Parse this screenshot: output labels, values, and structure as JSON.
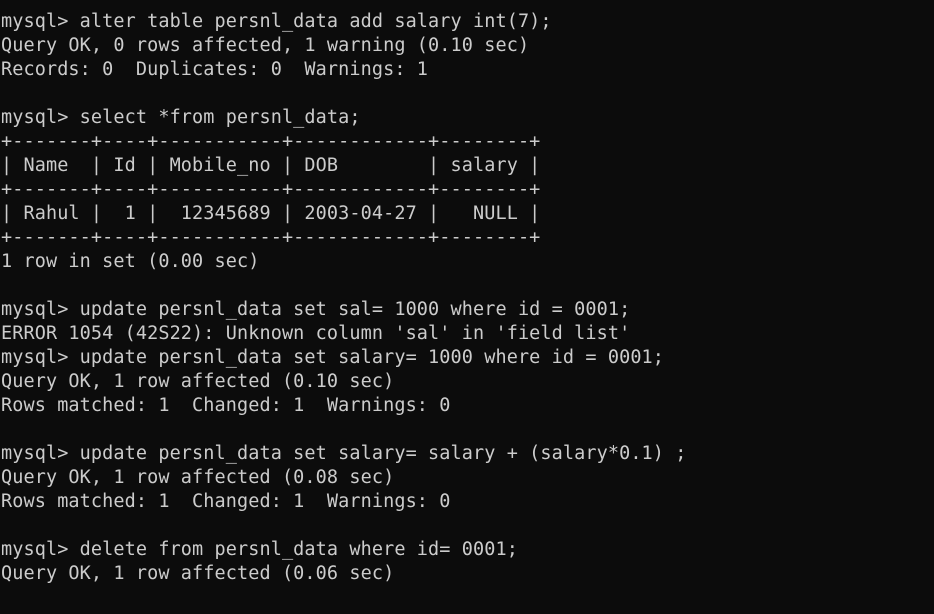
{
  "terminal": {
    "lines": [
      "mysql> alter table persnl_data add salary int(7);",
      "Query OK, 0 rows affected, 1 warning (0.10 sec)",
      "Records: 0  Duplicates: 0  Warnings: 1",
      "",
      "mysql> select *from persnl_data;",
      "+-------+----+-----------+------------+--------+",
      "| Name  | Id | Mobile_no | DOB        | salary |",
      "+-------+----+-----------+------------+--------+",
      "| Rahul |  1 |  12345689 | 2003-04-27 |   NULL |",
      "+-------+----+-----------+------------+--------+",
      "1 row in set (0.00 sec)",
      "",
      "mysql> update persnl_data set sal= 1000 where id = 0001;",
      "ERROR 1054 (42S22): Unknown column 'sal' in 'field list'",
      "mysql> update persnl_data set salary= 1000 where id = 0001;",
      "Query OK, 1 row affected (0.10 sec)",
      "Rows matched: 1  Changed: 1  Warnings: 0",
      "",
      "mysql> update persnl_data set salary= salary + (salary*0.1) ;",
      "Query OK, 1 row affected (0.08 sec)",
      "Rows matched: 1  Changed: 1  Warnings: 0",
      "",
      "mysql> delete from persnl_data where id= 0001;",
      "Query OK, 1 row affected (0.06 sec)"
    ]
  },
  "colors": {
    "background": "#0c0c0c",
    "text": "#cccccc"
  }
}
